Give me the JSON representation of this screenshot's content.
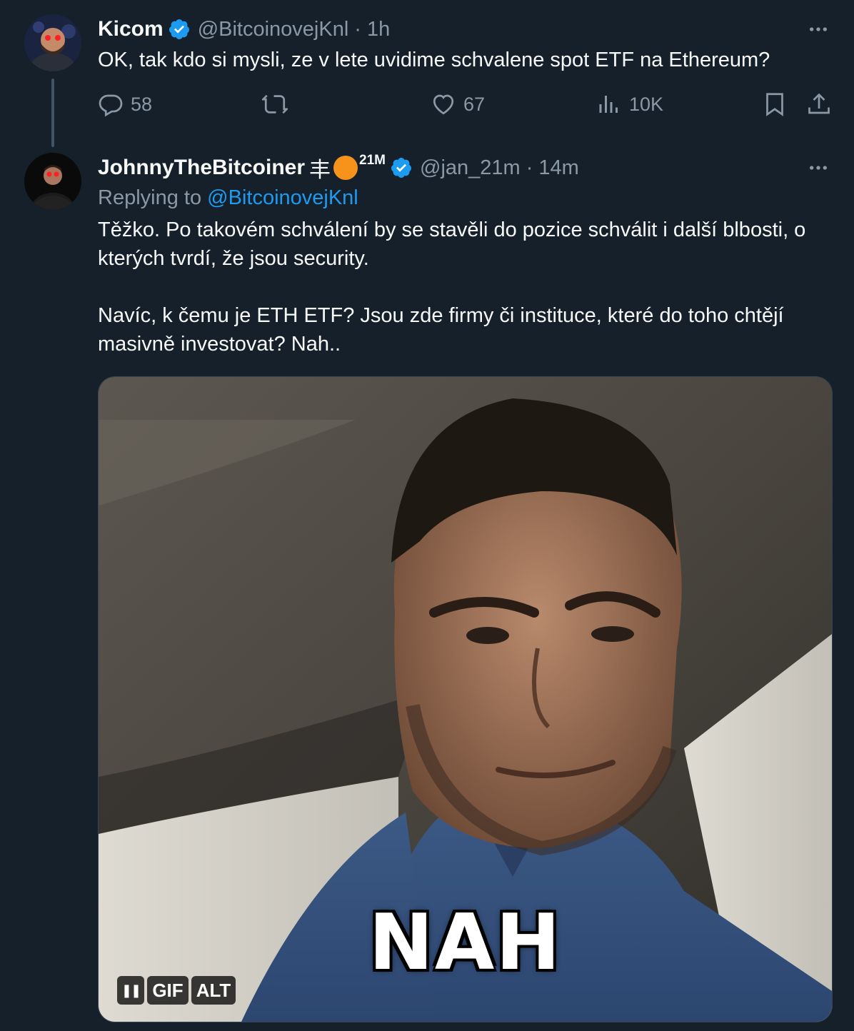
{
  "tweet1": {
    "name": "Kicom",
    "handle": "@BitcoinovejKnl",
    "sep": "·",
    "time": "1h",
    "text": "OK, tak kdo si mysli, ze v lete uvidime schvalene spot ETF na Ethereum?",
    "actions": {
      "replies": "58",
      "retweets": "",
      "likes": "67",
      "views": "10K"
    }
  },
  "tweet2": {
    "name": "JohnnyTheBitcoiner",
    "name_glyph": "丰",
    "name_suffix": "21M",
    "handle": "@jan_21m",
    "sep": "·",
    "time": "14m",
    "replying_prefix": "Replying to",
    "replying_handle": "@BitcoinovejKnl",
    "paragraph1": "Těžko. Po takovém schválení by se stavěli do pozice schválit i další blbosti, o kterých tvrdí, že jsou security.",
    "paragraph2": "Navíc, k čemu je ETH ETF? Jsou zde firmy či instituce, které do toho chtějí masivně investovat? Nah..",
    "media": {
      "caption": "NAH",
      "gif_label": "GIF",
      "alt_label": "ALT",
      "pause_glyph": "❚❚"
    }
  },
  "colors": {
    "background": "#15202b",
    "text": "#f7f9f9",
    "secondary": "#8b98a5",
    "accent": "#1d9bf0",
    "bitcoin_orange": "#f7931a"
  },
  "icons": [
    "verified-badge-icon",
    "more-icon",
    "reply-icon",
    "retweet-icon",
    "like-icon",
    "views-icon",
    "bookmark-icon",
    "share-icon",
    "pause-icon"
  ]
}
